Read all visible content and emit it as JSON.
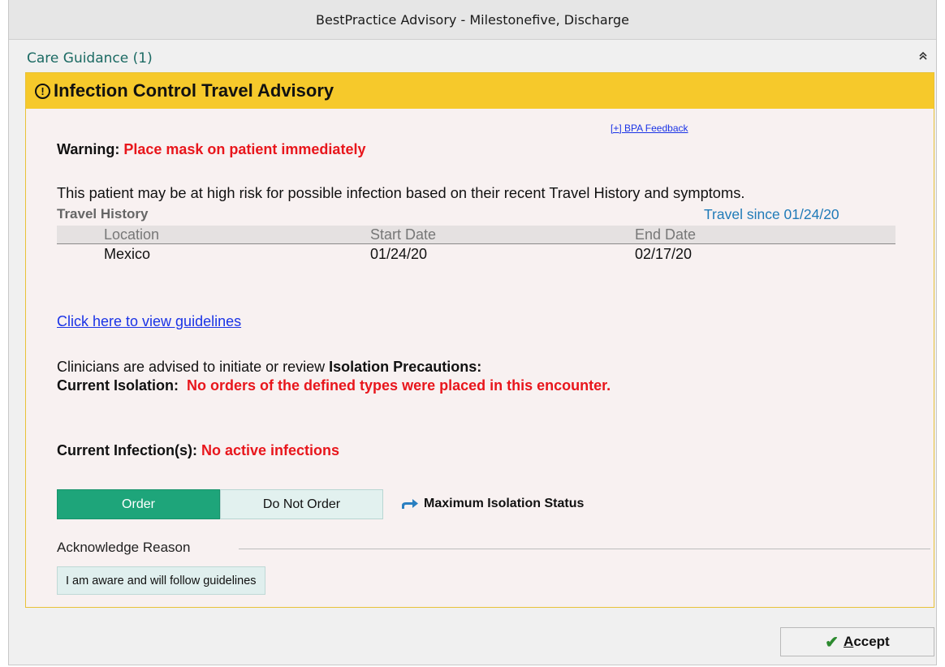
{
  "window": {
    "title": "BestPractice Advisory - Milestonefive, Discharge"
  },
  "section": {
    "title": "Care Guidance (1)",
    "collapse_icon": "double-chevron-up-icon"
  },
  "advisory": {
    "title": "Infection Control Travel Advisory",
    "header_icon": "exclamation-circle-icon",
    "feedback_link": "[+] BPA Feedback",
    "warning_label": "Warning:",
    "warning_text": "Place mask on patient immediately",
    "risk_text": "This patient may be at high risk for possible infection based on their recent Travel History and symptoms.",
    "travel_history_label": "Travel History",
    "travel_since": "Travel since 01/24/20",
    "table": {
      "headers": [
        "Location",
        "Start Date",
        "End Date"
      ],
      "rows": [
        [
          "Mexico",
          "01/24/20",
          "02/17/20"
        ]
      ]
    },
    "guidelines_link": "Click here to view guidelines",
    "clinicians_text": "Clinicians are advised to initiate or review",
    "isolation_precautions": "Isolation Precautions:",
    "current_isolation_label": "Current Isolation:",
    "current_isolation_value": "No orders of the defined types were placed in this encounter.",
    "current_infection_label": "Current Infection(s):",
    "current_infection_value": "No active infections",
    "order_button": "Order",
    "do_not_order_button": "Do Not Order",
    "max_isolation": "Maximum Isolation Status",
    "max_isolation_icon": "order-arrow-icon",
    "ack_label": "Acknowledge Reason",
    "ack_reason": "I am aware and will follow guidelines"
  },
  "footer": {
    "accept_check_icon": "checkmark-icon",
    "accept_first_letter": "A",
    "accept_rest": "ccept"
  },
  "colors": {
    "header_yellow": "#f6c92b",
    "card_bg": "#f8f1f1",
    "teal_title": "#1b6a63",
    "warning_red": "#e8161c",
    "link_blue": "#1a33e6",
    "order_green": "#1ea57a",
    "travel_since_blue": "#1f7ab8"
  }
}
